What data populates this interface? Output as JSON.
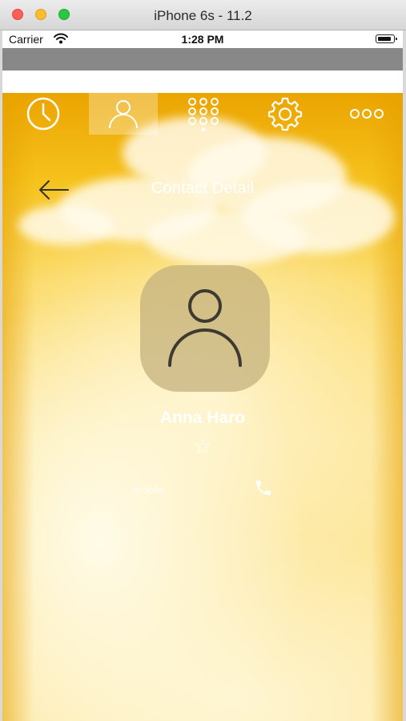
{
  "window": {
    "title": "iPhone 6s - 11.2"
  },
  "statusbar": {
    "carrier": "Carrier",
    "time": "1:28 PM"
  },
  "tabs": [
    {
      "name": "recents",
      "icon": "clock-icon",
      "active": false
    },
    {
      "name": "contacts",
      "icon": "person-icon",
      "active": true
    },
    {
      "name": "keypad",
      "icon": "keypad-icon",
      "active": false
    },
    {
      "name": "settings",
      "icon": "gear-icon",
      "active": false
    },
    {
      "name": "more",
      "icon": "more-icon",
      "active": false
    }
  ],
  "nav": {
    "title": "Contact Detail",
    "back_icon": "back-arrow-icon"
  },
  "contact": {
    "name": "Anna Haro",
    "avatar_icon": "person-icon",
    "favorite_glyph": "☆",
    "phone_label": "mobile",
    "phone_icon": "phone-icon"
  },
  "colors": {
    "accent_top": "#eba400",
    "accent_mid": "#fbdb6a",
    "text_light": "#ffffff",
    "avatar_bg": "#c4b27d",
    "traffic_red": "#fc5f57",
    "traffic_yellow": "#fdbb2e",
    "traffic_green": "#29c840"
  }
}
